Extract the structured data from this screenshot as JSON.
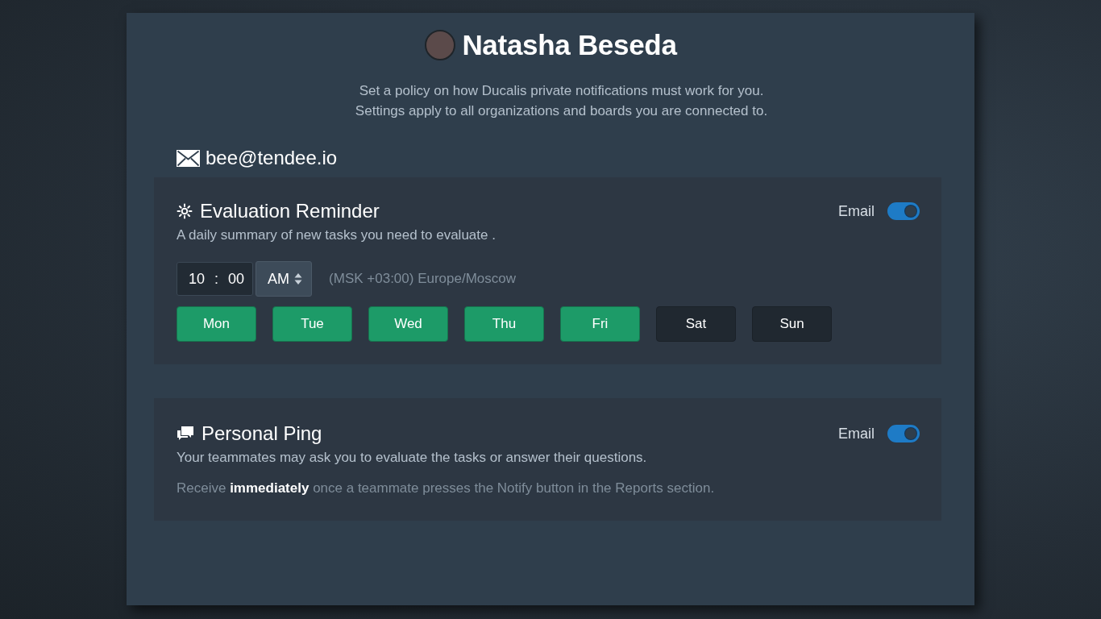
{
  "profile": {
    "name": "Natasha Beseda"
  },
  "intro": [
    "Set a policy on how Ducalis private notifications must work for you.",
    "Settings apply to all organizations and boards you are connected to."
  ],
  "email": "bee@tendee.io",
  "cards": [
    {
      "kind": "reminder",
      "title": "Evaluation Reminder",
      "description": "A daily summary of new tasks you need to evaluate .",
      "channel": {
        "label": "Email",
        "on": true
      },
      "time": {
        "hour": "10",
        "separator": ":",
        "minute": "00",
        "period": "AM"
      },
      "timezone": "(MSK +03:00) Europe/Moscow",
      "days": [
        {
          "label": "Mon",
          "selected": true
        },
        {
          "label": "Tue",
          "selected": true
        },
        {
          "label": "Wed",
          "selected": true
        },
        {
          "label": "Thu",
          "selected": true
        },
        {
          "label": "Fri",
          "selected": true
        },
        {
          "label": "Sat",
          "selected": false
        },
        {
          "label": "Sun",
          "selected": false
        }
      ]
    },
    {
      "kind": "ping",
      "title": "Personal Ping",
      "description": "Your teammates may ask you to evaluate the tasks or answer their questions.",
      "channel": {
        "label": "Email",
        "on": true
      },
      "note": "Receive **immediately** once a teammate presses the Notify button in the Reports section."
    }
  ]
}
